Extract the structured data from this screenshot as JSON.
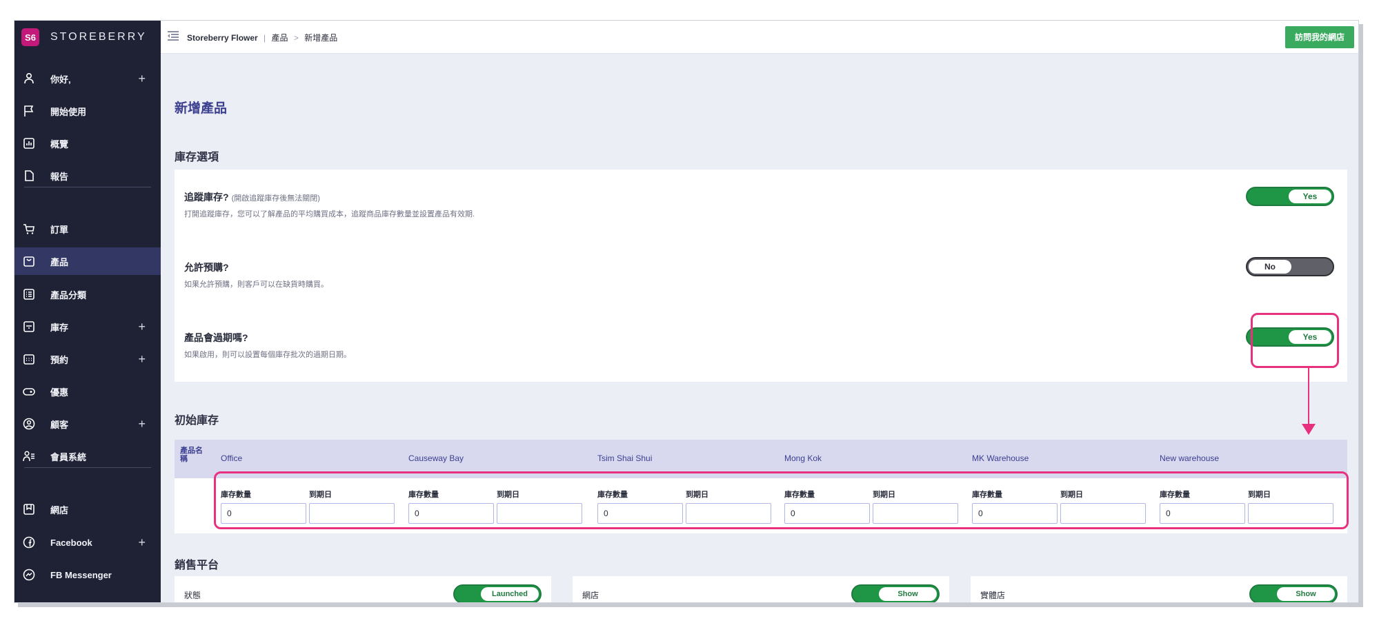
{
  "brand": {
    "logo_text": "S6",
    "name": "STOREBERRY"
  },
  "sidebar": {
    "items": [
      {
        "label": "你好,",
        "icon": "user-icon",
        "plus": "+"
      },
      {
        "label": "開始使用",
        "icon": "flag-icon",
        "plus": ""
      },
      {
        "label": "概覽",
        "icon": "dashboard-chart-icon",
        "plus": ""
      },
      {
        "label": "報告",
        "icon": "document-icon",
        "plus": ""
      },
      {
        "label": "訂單",
        "icon": "cart-icon",
        "plus": ""
      },
      {
        "label": "產品",
        "icon": "product-box-icon",
        "plus": ""
      },
      {
        "label": "產品分類",
        "icon": "category-list-icon",
        "plus": ""
      },
      {
        "label": "庫存",
        "icon": "inventory-icon",
        "plus": "+"
      },
      {
        "label": "預約",
        "icon": "calendar-icon",
        "plus": "+"
      },
      {
        "label": "優惠",
        "icon": "coupon-icon",
        "plus": ""
      },
      {
        "label": "顧客",
        "icon": "customer-icon",
        "plus": "+"
      },
      {
        "label": "會員系統",
        "icon": "membership-icon",
        "plus": ""
      },
      {
        "label": "網店",
        "icon": "webstore-icon",
        "plus": ""
      },
      {
        "label": "Facebook",
        "icon": "facebook-icon",
        "plus": "+"
      },
      {
        "label": "FB Messenger",
        "icon": "messenger-icon",
        "plus": ""
      }
    ],
    "active_index": 5
  },
  "topbar": {
    "breadcrumb_store": "Storeberry Flower",
    "breadcrumb_sep1": "|",
    "breadcrumb_section": "產品",
    "breadcrumb_sep2": ">",
    "breadcrumb_page": "新增產品",
    "visit_button": "訪問我的網店"
  },
  "page": {
    "title": "新增產品"
  },
  "inventory_options": {
    "section_title": "庫存選項",
    "options": [
      {
        "title": "追蹤庫存?",
        "note": "(開啟追蹤庫存後無法關閉)",
        "desc": "打開追蹤庫存，您可以了解產品的平均購買成本，追蹤商品庫存數量並設置產品有效期.",
        "toggle": "Yes",
        "on": true
      },
      {
        "title": "允許預購?",
        "note": "",
        "desc": "如果允許預購，則客戶可以在缺貨時購買。",
        "toggle": "No",
        "on": false
      },
      {
        "title": "產品會過期嗎?",
        "note": "",
        "desc": "如果啟用，則可以設置每個庫存批次的過期日期。",
        "toggle": "Yes",
        "on": true
      }
    ]
  },
  "initial_stock": {
    "section_title": "初始庫存",
    "product_name_header": "產品名稱",
    "qty_label": "庫存數量",
    "expiry_label": "到期日",
    "locations": [
      {
        "name": "Office",
        "qty": "0",
        "expiry": ""
      },
      {
        "name": "Causeway Bay",
        "qty": "0",
        "expiry": ""
      },
      {
        "name": "Tsim Shai Shui",
        "qty": "0",
        "expiry": ""
      },
      {
        "name": "Mong Kok",
        "qty": "0",
        "expiry": ""
      },
      {
        "name": "MK Warehouse",
        "qty": "0",
        "expiry": ""
      },
      {
        "name": "New warehouse",
        "qty": "0",
        "expiry": ""
      }
    ]
  },
  "sales_platforms": {
    "section_title": "銷售平台",
    "items": [
      {
        "label": "狀態",
        "toggle": "Launched"
      },
      {
        "label": "網店",
        "toggle": "Show"
      },
      {
        "label": "實體店",
        "toggle": "Show"
      }
    ]
  },
  "colors": {
    "accent_purple": "#3b3f8f",
    "toggle_green": "#1e9646",
    "highlight_pink": "#e7317f",
    "sidebar_bg": "#1f2235"
  }
}
